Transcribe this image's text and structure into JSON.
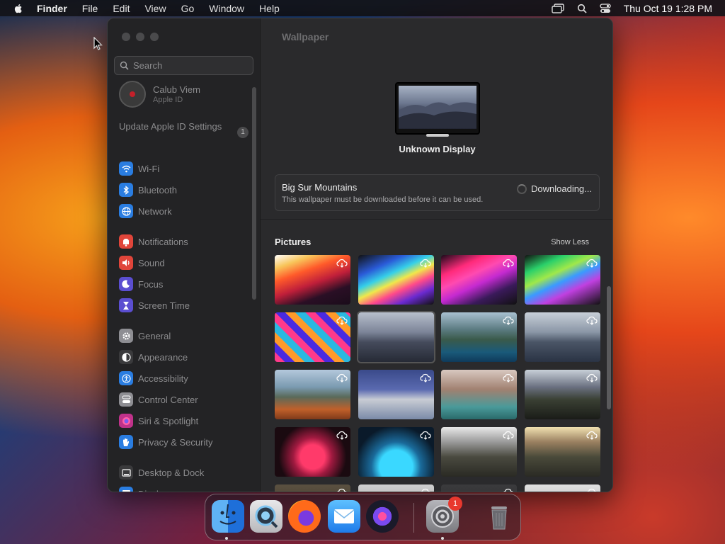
{
  "menubar": {
    "app_name": "Finder",
    "items": [
      "File",
      "Edit",
      "View",
      "Go",
      "Window",
      "Help"
    ],
    "clock": "Thu Oct 19  1:28 PM"
  },
  "sidebar": {
    "search_placeholder": "Search",
    "profile": {
      "name": "Calub Viem",
      "subtitle": "Apple ID"
    },
    "update": {
      "label": "Update Apple ID Settings",
      "badge": "1"
    },
    "groups": [
      [
        {
          "label": "Wi-Fi",
          "icon": "wifi-icon",
          "color": "#2a7de1"
        },
        {
          "label": "Bluetooth",
          "icon": "bluetooth-icon",
          "color": "#2a7de1"
        },
        {
          "label": "Network",
          "icon": "globe-icon",
          "color": "#2a7de1"
        }
      ],
      [
        {
          "label": "Notifications",
          "icon": "bell-icon",
          "color": "#e0453a"
        },
        {
          "label": "Sound",
          "icon": "speaker-icon",
          "color": "#e0453a"
        },
        {
          "label": "Focus",
          "icon": "moon-icon",
          "color": "#5b4ed1"
        },
        {
          "label": "Screen Time",
          "icon": "hourglass-icon",
          "color": "#5b4ed1"
        }
      ],
      [
        {
          "label": "General",
          "icon": "gear-icon",
          "color": "#8e8e93"
        },
        {
          "label": "Appearance",
          "icon": "appearance-icon",
          "color": "#3a3a3c"
        },
        {
          "label": "Accessibility",
          "icon": "accessibility-icon",
          "color": "#2a7de1"
        },
        {
          "label": "Control Center",
          "icon": "control-center-icon",
          "color": "#8e8e93"
        },
        {
          "label": "Siri & Spotlight",
          "icon": "siri-icon",
          "color": "#c0328a"
        },
        {
          "label": "Privacy & Security",
          "icon": "hand-icon",
          "color": "#2a7de1"
        }
      ],
      [
        {
          "label": "Desktop & Dock",
          "icon": "dock-icon",
          "color": "#3a3a3c"
        },
        {
          "label": "Displays",
          "icon": "display-icon",
          "color": "#2a7de1"
        }
      ]
    ]
  },
  "main": {
    "title": "Wallpaper",
    "display_name": "Unknown Display",
    "wallpaper": {
      "name": "Big Sur Mountains",
      "note": "This wallpaper must be downloaded before it can be used.",
      "status": "Downloading..."
    },
    "pictures_title": "Pictures",
    "show_less": "Show Less"
  },
  "dock": {
    "apps": [
      "Finder",
      "QuickTime Player",
      "Firefox",
      "Mail",
      "Siri",
      "System Settings",
      "Trash"
    ],
    "badge": "1"
  }
}
